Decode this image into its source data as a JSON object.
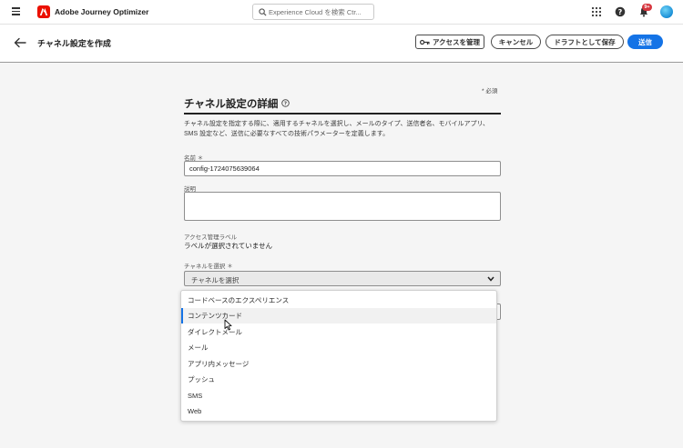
{
  "topnav": {
    "app_title": "Adobe Journey Optimizer",
    "search_placeholder": "Experience Cloud を検索 Ctr...",
    "notification_count": "9+",
    "icons": [
      "menu-icon",
      "adobe-logo",
      "search-icon",
      "apps-grid-icon",
      "help-icon",
      "bell-icon",
      "avatar"
    ]
  },
  "header": {
    "title": "チャネル設定を作成",
    "buttons": {
      "access": "アクセスを管理",
      "cancel": "キャンセル",
      "draft": "ドラフトとして保存",
      "send": "送信"
    }
  },
  "form": {
    "required_note": "* 必須",
    "section_title": "チャネル設定の詳細",
    "description": "チャネル設定を指定する際に、適用するチャネルを選択し、メールのタイプ、送信者名、モバイルアプリ、SMS 設定など、送信に必要なすべての技術パラメーターを定義します。",
    "name_label": "名前 ＊",
    "name_value": "config-1724075639064",
    "desc_label": "説明",
    "desc_value": "",
    "access_label": "アクセス管理ラベル",
    "access_value": "ラベルが選択されていません",
    "channel_label": "チャネルを選択 ＊",
    "channel_placeholder": "チャネルを選択"
  },
  "dropdown": {
    "options": [
      "コードベースのエクスペリエンス",
      "コンテンツカード",
      "ダイレクトメール",
      "メール",
      "アプリ内メッセージ",
      "プッシュ",
      "SMS",
      "Web"
    ],
    "hovered_index": 1
  },
  "colors": {
    "accent": "#1473e6",
    "brand": "#eb1000",
    "badge": "#d7373f"
  }
}
